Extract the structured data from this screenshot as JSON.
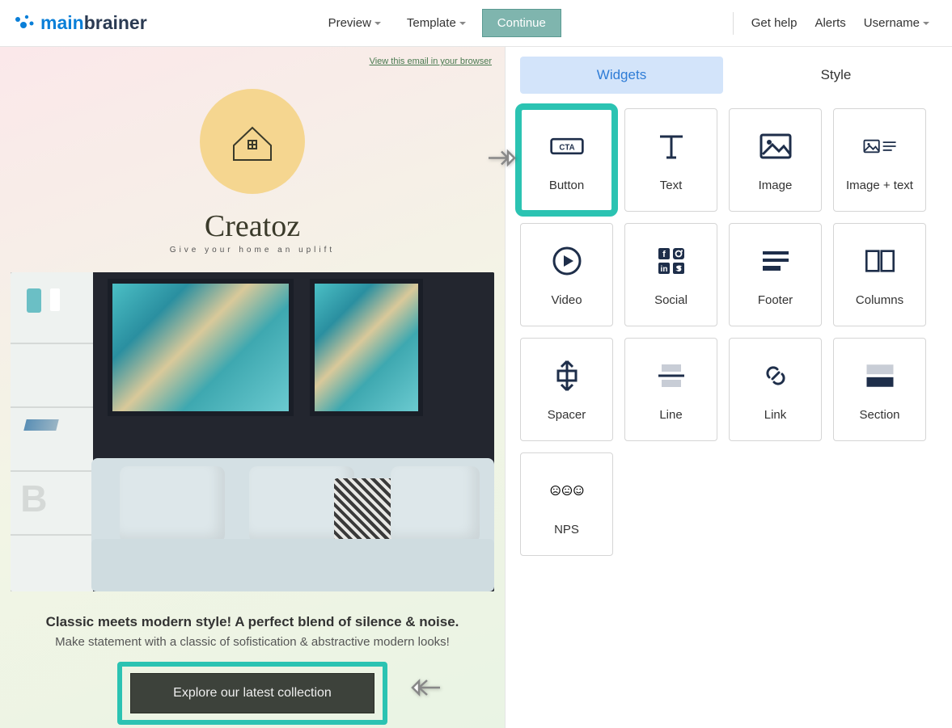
{
  "header": {
    "logo_main": "main",
    "logo_brainer": "brainer",
    "preview": "Preview",
    "template": "Template",
    "continue": "Continue",
    "get_help": "Get help",
    "alerts": "Alerts",
    "username": "Username"
  },
  "canvas": {
    "browser_link": "View this email in your browser",
    "brand": "Creatoz",
    "brand_sub": "Give your home an uplift",
    "headline": "Classic meets modern style! A perfect blend of silence & noise.",
    "subtext": "Make statement with a classic of sofistication & abstractive modern looks!",
    "cta": "Explore our latest collection"
  },
  "panel": {
    "tabs": {
      "widgets": "Widgets",
      "style": "Style"
    },
    "widgets": [
      {
        "label": "Button"
      },
      {
        "label": "Text"
      },
      {
        "label": "Image"
      },
      {
        "label": "Image + text"
      },
      {
        "label": "Video"
      },
      {
        "label": "Social"
      },
      {
        "label": "Footer"
      },
      {
        "label": "Columns"
      },
      {
        "label": "Spacer"
      },
      {
        "label": "Line"
      },
      {
        "label": "Link"
      },
      {
        "label": "Section"
      },
      {
        "label": "NPS"
      }
    ]
  }
}
